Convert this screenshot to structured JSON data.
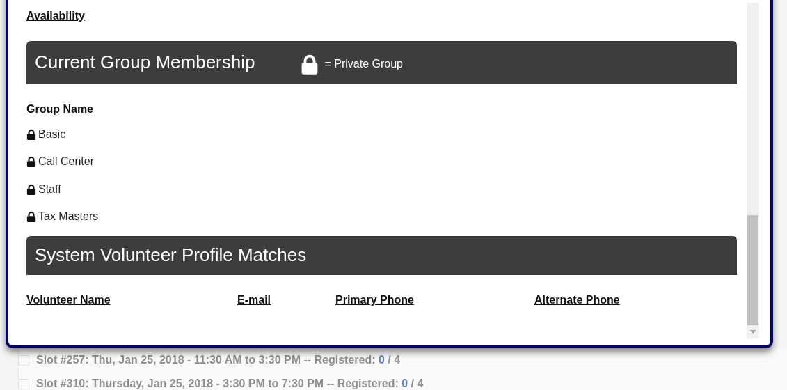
{
  "modal": {
    "availability_link": "Availability",
    "group_section": {
      "title": "Current Group Membership",
      "legend": "= Private Group",
      "column": "Group Name",
      "groups": [
        {
          "name": "Basic",
          "private": true
        },
        {
          "name": "Call Center",
          "private": true
        },
        {
          "name": "Staff",
          "private": true
        },
        {
          "name": "Tax Masters",
          "private": true
        }
      ]
    },
    "matches_section": {
      "title": "System Volunteer Profile Matches",
      "columns": [
        "Volunteer Name",
        "E-mail",
        "Primary Phone",
        "Alternate Phone"
      ]
    }
  },
  "background_slots": [
    {
      "text": "Slot #257: Thu, Jan 25, 2018 - 11:30 AM to 3:30 PM -- Registered: ",
      "registered": "0",
      "capacity": " / 4",
      "checked": false
    },
    {
      "text": "Slot #310: Thursday, Jan 25, 2018 - 3:30 PM to 7:30 PM -- Registered: ",
      "registered": "0",
      "capacity": " / 4",
      "checked": false
    }
  ]
}
